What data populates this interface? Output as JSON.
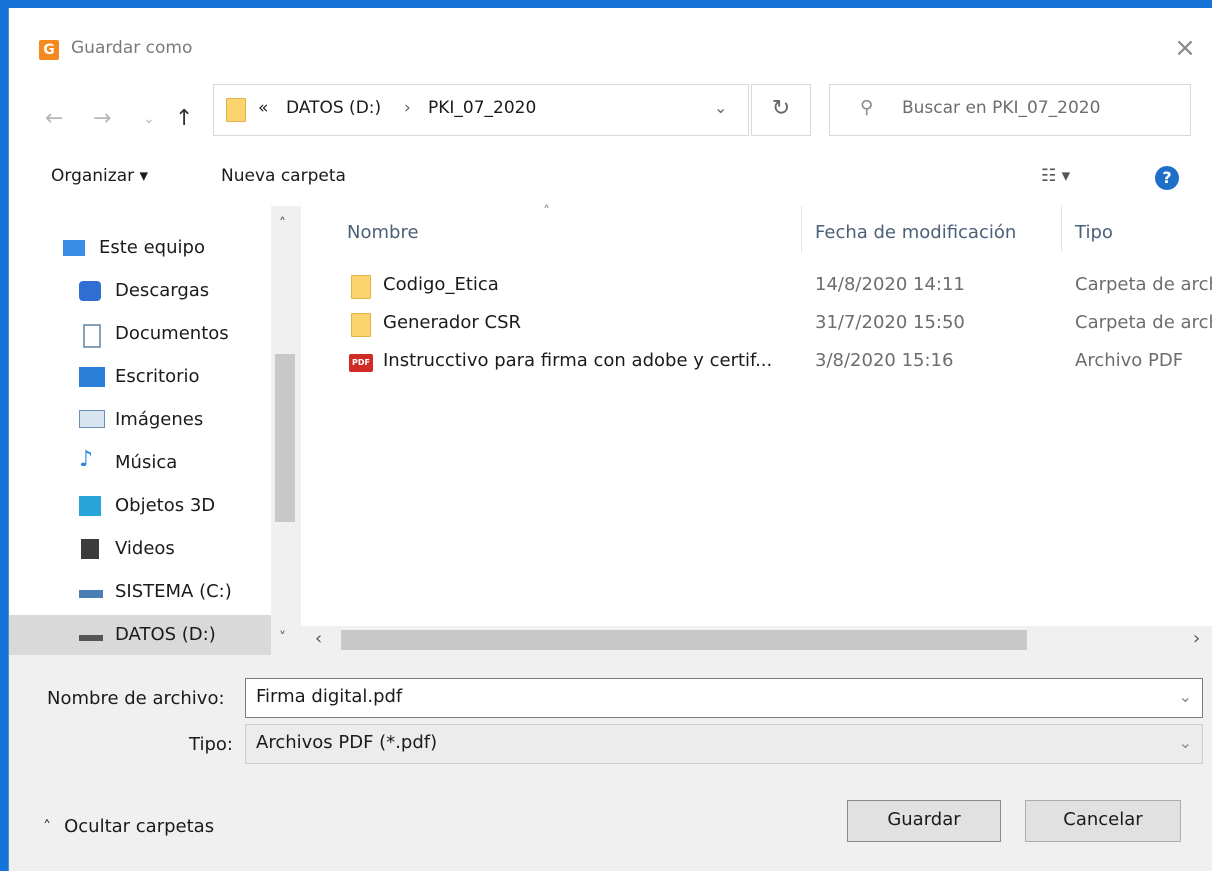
{
  "window": {
    "title": "Guardar como",
    "close_glyph": "×",
    "app_icon": "app-logo-icon"
  },
  "nav": {
    "back_glyph": "←",
    "forward_glyph": "→",
    "recent_glyph": "⌄",
    "up_glyph": "↑",
    "address": {
      "overflow": "«",
      "drive": "DATOS (D:)",
      "separator": "›",
      "folder": "PKI_07_2020",
      "dropdown_glyph": "⌄"
    },
    "refresh_glyph": "↻",
    "search": {
      "icon_glyph": "⚲",
      "placeholder": "Buscar en PKI_07_2020"
    }
  },
  "toolbar": {
    "organize": "Organizar ▾",
    "new_folder": "Nueva carpeta",
    "view_glyph": "☷ ▾",
    "help": "?"
  },
  "sidebar": {
    "up_glyph": "˄",
    "down_glyph": "˅",
    "items": [
      {
        "label": "Este equipo",
        "icon": "computer-icon",
        "color": "#3a8ee6"
      },
      {
        "label": "Descargas",
        "icon": "download-icon",
        "color": "#2f6fd1"
      },
      {
        "label": "Documentos",
        "icon": "document-icon",
        "color": "#8aa0b8"
      },
      {
        "label": "Escritorio",
        "icon": "desktop-icon",
        "color": "#2b7fd9"
      },
      {
        "label": "Imágenes",
        "icon": "pictures-icon",
        "color": "#6e8fb3"
      },
      {
        "label": "Música",
        "icon": "music-icon",
        "color": "#2c86e0"
      },
      {
        "label": "Objetos 3D",
        "icon": "3d-objects-icon",
        "color": "#2aa5d9"
      },
      {
        "label": "Videos",
        "icon": "videos-icon",
        "color": "#3c3c3c"
      },
      {
        "label": "SISTEMA (C:)",
        "icon": "drive-icon",
        "color": "#4a7fb5"
      },
      {
        "label": "DATOS (D:)",
        "icon": "drive-icon",
        "color": "#555555"
      }
    ]
  },
  "files": {
    "sort_glyph": "˄",
    "columns": [
      "Nombre",
      "Fecha de modificación",
      "Tipo"
    ],
    "rows": [
      {
        "name": "Codigo_Etica",
        "date": "14/8/2020 14:11",
        "type": "Carpeta de arch",
        "icon": "folder-icon"
      },
      {
        "name": "Generador CSR",
        "date": "31/7/2020 15:50",
        "type": "Carpeta de arch",
        "icon": "folder-icon"
      },
      {
        "name": "Instrucctivo para firma con adobe y certif...",
        "date": "3/8/2020 15:16",
        "type": "Archivo PDF",
        "icon": "pdf-icon",
        "icon_text": "PDF"
      }
    ],
    "scroll_left": "‹",
    "scroll_right": "›"
  },
  "form": {
    "filename_label": "Nombre de archivo:",
    "filename_value": "Firma digital.pdf",
    "type_label": "Tipo:",
    "type_value": "Archivos PDF (*.pdf)",
    "dropdown_glyph": "⌄"
  },
  "footer": {
    "hide_folders_glyph": "˄",
    "hide_folders": "Ocultar carpetas",
    "save": "Guardar",
    "cancel": "Cancelar"
  }
}
